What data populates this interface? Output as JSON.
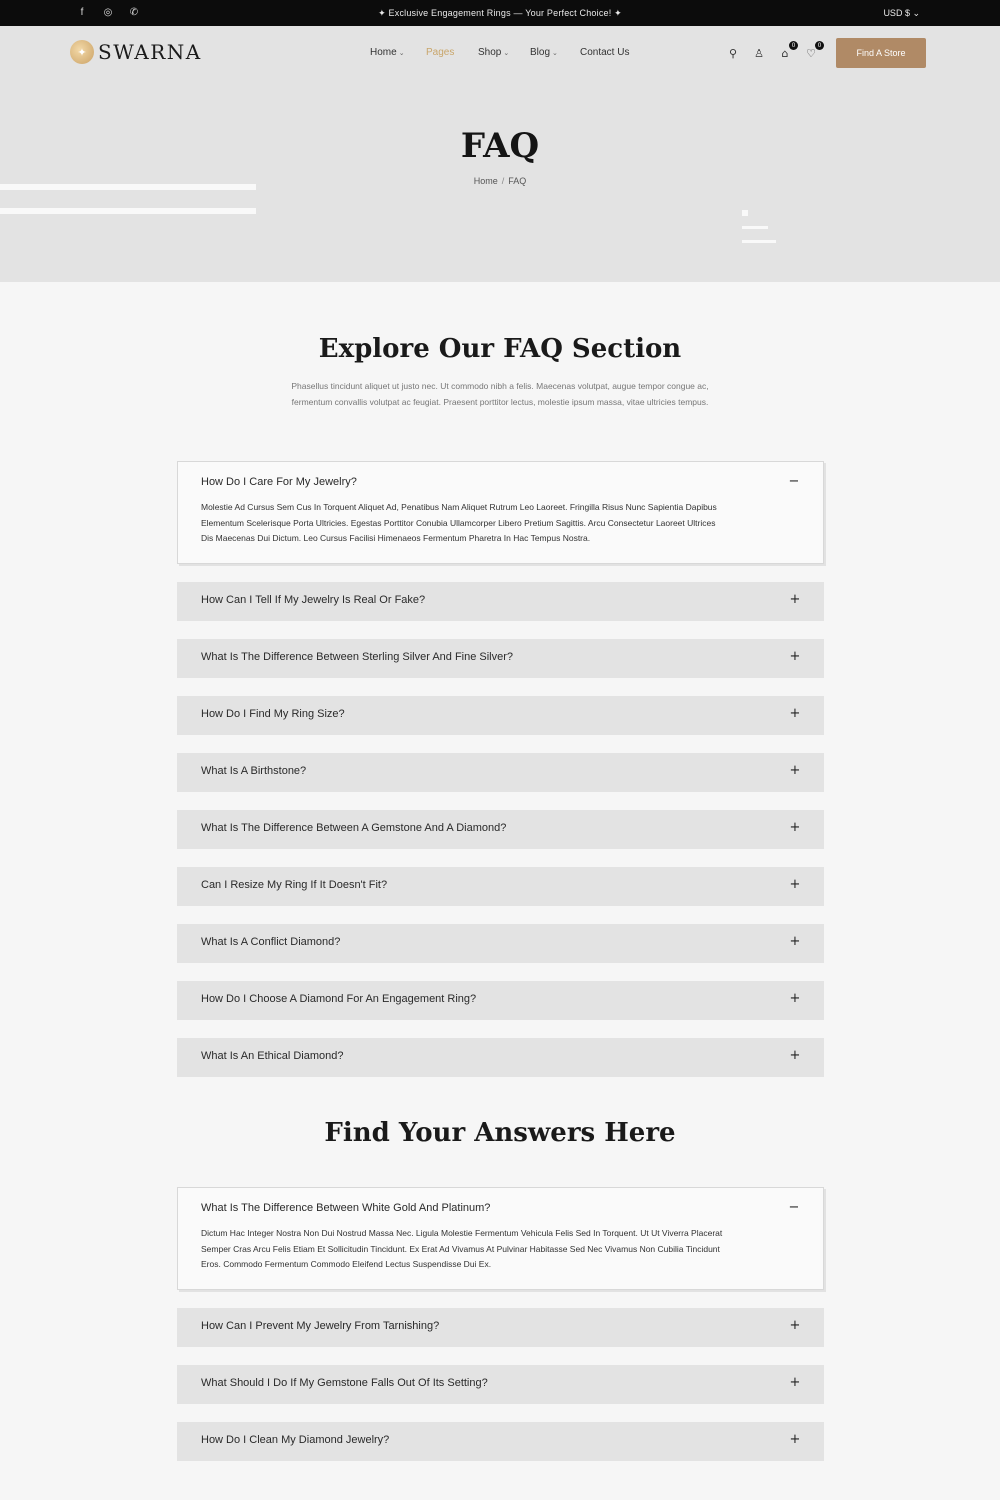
{
  "topbar": {
    "socials": [
      {
        "icon": "facebook-icon",
        "glyph": "f"
      },
      {
        "icon": "instagram-icon",
        "glyph": "◎"
      },
      {
        "icon": "whatsapp-icon",
        "glyph": "✆"
      }
    ],
    "announcement": "✦ Exclusive Engagement Rings — Your Perfect Choice! ✦",
    "currency": "USD $ ⌄"
  },
  "header": {
    "logo_text": "SWARNA",
    "nav": [
      {
        "label": "Home",
        "has_caret": true,
        "active": false
      },
      {
        "label": "Pages",
        "has_caret": false,
        "active": true
      },
      {
        "label": "Shop",
        "has_caret": true,
        "active": false
      },
      {
        "label": "Blog",
        "has_caret": true,
        "active": false
      },
      {
        "label": "Contact Us",
        "has_caret": false,
        "active": false
      }
    ],
    "icons": {
      "search": "⚲",
      "account": "♙",
      "cart": "⌂",
      "cart_count": "0",
      "wishlist": "♡",
      "wishlist_count": "0"
    },
    "store_button": "Find A Store",
    "page_title": "FAQ",
    "breadcrumb": {
      "home": "Home",
      "separator": "/",
      "current": "FAQ"
    }
  },
  "faq_section": {
    "title": "Explore Our FAQ Section",
    "description": "Phasellus tincidunt aliquet ut justo nec. Ut commodo nibh a felis. Maecenas volutpat, augue tempor congue ac, fermentum convallis volutpat ac feugiat. Praesent porttitor lectus, molestie ipsum massa, vitae ultricies tempus.",
    "items": [
      {
        "question": "How Do I Care For My Jewelry?",
        "open": true,
        "answer": "Molestie Ad Cursus Sem Cus In Torquent Aliquet Ad, Penatibus Nam Aliquet Rutrum Leo Laoreet. Fringilla Risus Nunc Sapientia Dapibus Elementum Scelerisque Porta Ultricies. Egestas Porttitor Conubia Ullamcorper Libero Pretium Sagittis. Arcu Consectetur Laoreet Ultrices Dis Maecenas Dui Dictum. Leo Cursus Facilisi Himenaeos Fermentum Pharetra In Hac Tempus Nostra."
      },
      {
        "question": "How Can I Tell If My Jewelry Is Real Or Fake?",
        "open": false
      },
      {
        "question": "What Is The Difference Between Sterling Silver And Fine Silver?",
        "open": false
      },
      {
        "question": "How Do I Find My Ring Size?",
        "open": false
      },
      {
        "question": "What Is A Birthstone?",
        "open": false
      },
      {
        "question": "What Is The Difference Between A Gemstone And A Diamond?",
        "open": false
      },
      {
        "question": "Can I Resize My Ring If It Doesn't Fit?",
        "open": false
      },
      {
        "question": "What Is A Conflict Diamond?",
        "open": false
      },
      {
        "question": "How Do I Choose A Diamond For An Engagement Ring?",
        "open": false
      },
      {
        "question": "What Is An Ethical Diamond?",
        "open": false
      }
    ]
  },
  "answers_section": {
    "title": "Find Your Answers Here",
    "items": [
      {
        "question": "What Is The Difference Between White Gold And Platinum?",
        "open": true,
        "answer": "Dictum Hac Integer Nostra Non Dui Nostrud Massa Nec. Ligula Molestie Fermentum Vehicula Felis Sed In Torquent. Ut Ut Viverra Placerat Semper Cras Arcu Felis Etiam Et Sollicitudin Tincidunt. Ex Erat Ad Vivamus At Pulvinar Habitasse Sed Nec Vivamus Non Cubilia Tincidunt Eros. Commodo Fermentum Commodo Eleifend Lectus Suspendisse Dui Ex."
      },
      {
        "question": "How Can I Prevent My Jewelry From Tarnishing?",
        "open": false
      },
      {
        "question": "What Should I Do If My Gemstone Falls Out Of Its Setting?",
        "open": false
      },
      {
        "question": "How Do I Clean My Diamond Jewelry?",
        "open": false
      }
    ]
  },
  "toggle_symbols": {
    "open": "−",
    "closed": "+"
  },
  "colors": {
    "accent": "#c9a66b",
    "button": "#b08a66",
    "topbar": "#0c0c0c",
    "hero_bg": "#e3e3e3"
  }
}
